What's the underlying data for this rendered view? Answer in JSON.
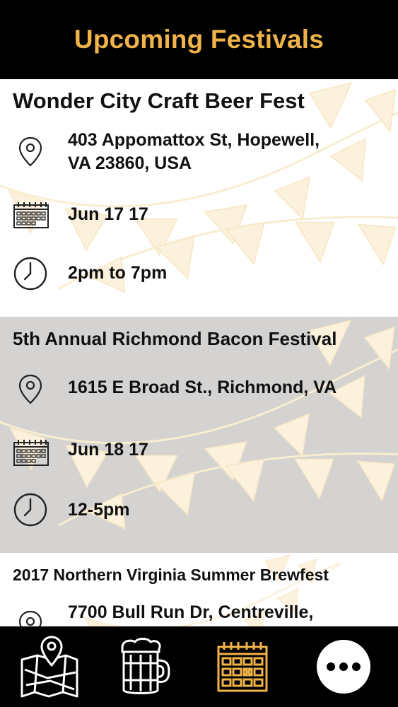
{
  "header": {
    "title": "Upcoming Festivals"
  },
  "festivals": [
    {
      "name": "Wonder City Craft Beer Fest",
      "address": "403 Appomattox St, Hopewell,\nVA 23860, USA",
      "date": "Jun 17 17",
      "time": "2pm to 7pm"
    },
    {
      "name": "5th Annual Richmond Bacon Festival",
      "address": "1615 E Broad St., Richmond, VA",
      "date": "Jun 18 17",
      "time": "12-5pm"
    },
    {
      "name": "2017 Northern Virginia Summer Brewfest",
      "address": "7700 Bull Run Dr, Centreville,"
    }
  ],
  "tabbar": {
    "items": [
      {
        "icon": "map-pin-icon"
      },
      {
        "icon": "beer-mug-icon"
      },
      {
        "icon": "calendar-icon"
      },
      {
        "icon": "more-icon"
      }
    ]
  },
  "colors": {
    "accent": "#f0b34a",
    "header_bg": "#000000",
    "alt_row": "#d4d3d2",
    "bunting": "#fbf3df"
  }
}
